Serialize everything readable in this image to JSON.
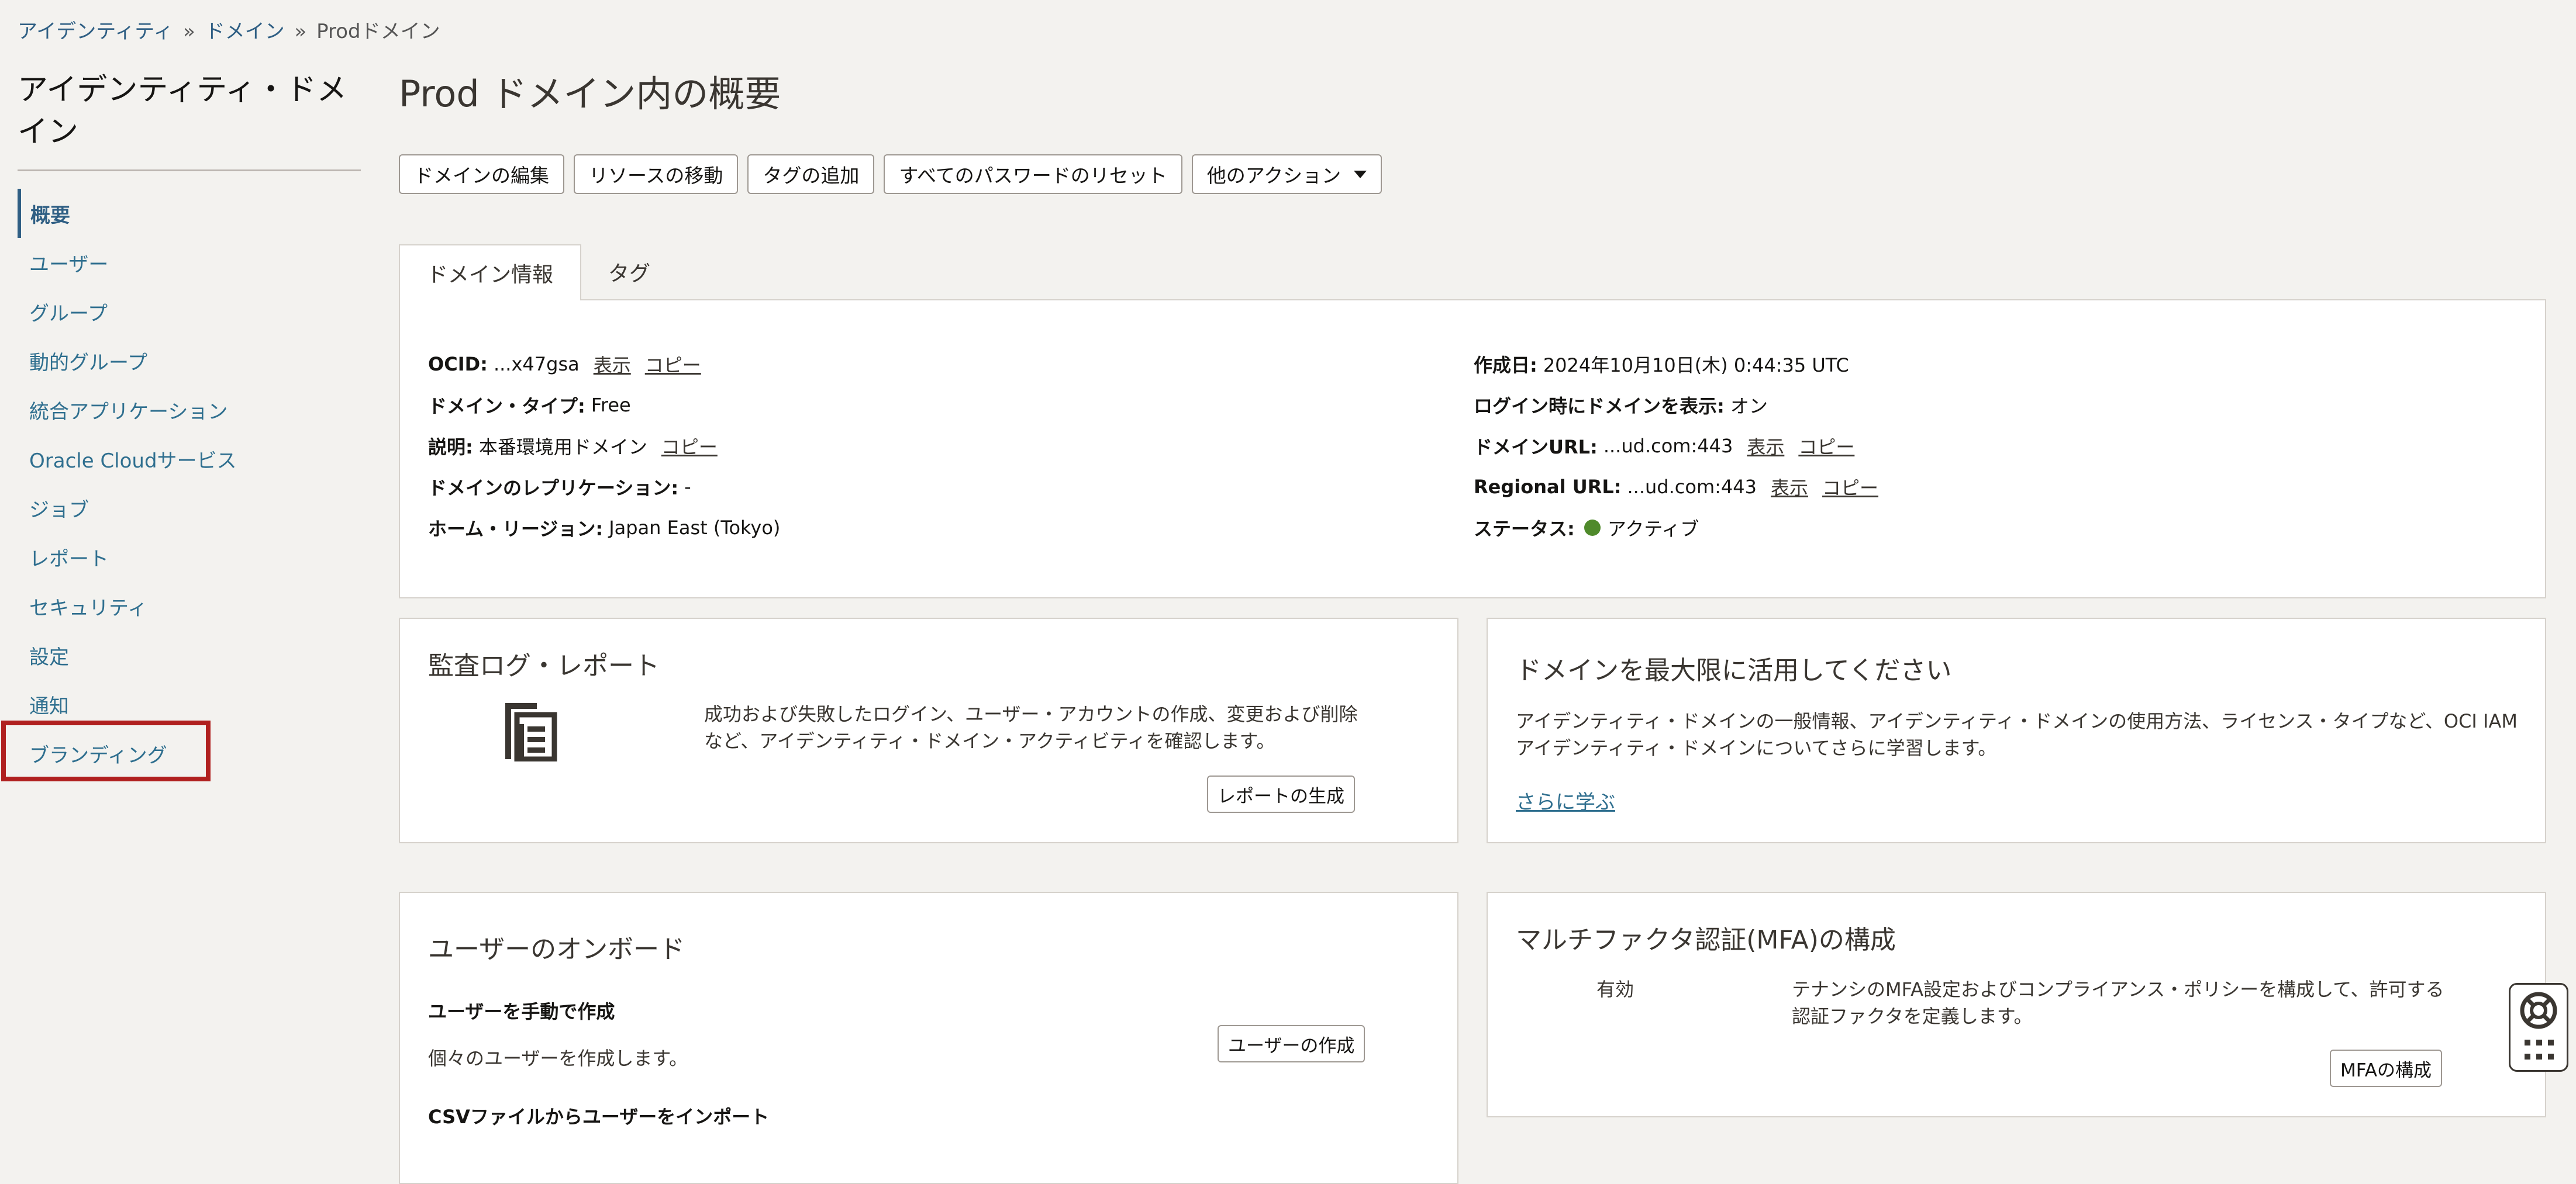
{
  "breadcrumb": {
    "items": [
      "アイデンティティ",
      "ドメイン",
      "Prodドメイン"
    ],
    "separator": "»"
  },
  "sidebar": {
    "title": "アイデンティティ・ドメイン",
    "items": [
      {
        "label": "概要",
        "active": true
      },
      {
        "label": "ユーザー"
      },
      {
        "label": "グループ"
      },
      {
        "label": "動的グループ"
      },
      {
        "label": "統合アプリケーション"
      },
      {
        "label": "Oracle Cloudサービス"
      },
      {
        "label": "ジョブ"
      },
      {
        "label": "レポート"
      },
      {
        "label": "セキュリティ"
      },
      {
        "label": "設定"
      },
      {
        "label": "通知"
      },
      {
        "label": "ブランディング",
        "highlighted": true
      }
    ]
  },
  "main": {
    "title": "Prod ドメイン内の概要",
    "actions": {
      "edit_domain": "ドメインの編集",
      "move_resource": "リソースの移動",
      "add_tags": "タグの追加",
      "reset_passwords": "すべてのパスワードのリセット",
      "more_actions": "他のアクション"
    },
    "tabs": [
      {
        "label": "ドメイン情報",
        "active": true
      },
      {
        "label": "タグ"
      }
    ],
    "info": {
      "ocid_key": "OCID:",
      "ocid_value": "...x47gsa",
      "show": "表示",
      "copy": "コピー",
      "domain_type_key": "ドメイン・タイプ:",
      "domain_type_value": "Free",
      "description_key": "説明:",
      "description_value": "本番環境用ドメイン",
      "replication_key": "ドメインのレプリケーション:",
      "replication_value": "-",
      "home_region_key": "ホーム・リージョン:",
      "home_region_value": "Japan East (Tokyo)",
      "created_key": "作成日:",
      "created_value": "2024年10月10日(木) 0:44:35 UTC",
      "show_on_login_key": "ログイン時にドメインを表示:",
      "show_on_login_value": "オン",
      "domain_url_key": "ドメインURL:",
      "domain_url_value": "...ud.com:443",
      "regional_url_key": "Regional URL:",
      "regional_url_value": "...ud.com:443",
      "status_key": "ステータス:",
      "status_value": "アクティブ",
      "status_color": "#4f8a2b"
    },
    "cards": {
      "audit": {
        "title": "監査ログ・レポート",
        "icon": "report-document-icon",
        "text": "成功および失敗したログイン、ユーザー・アカウントの作成、変更および削除など、アイデンティティ・ドメイン・アクティビティを確認します。",
        "button": "レポートの生成"
      },
      "maximize": {
        "title": "ドメインを最大限に活用してください",
        "text": "アイデンティティ・ドメインの一般情報、アイデンティティ・ドメインの使用方法、ライセンス・タイプなど、OCI IAMアイデンティティ・ドメインについてさらに学習します。",
        "link": "さらに学ぶ"
      },
      "onboard": {
        "title": "ユーザーのオンボード",
        "manual_title": "ユーザーを手動で作成",
        "manual_text": "個々のユーザーを作成します。",
        "button": "ユーザーの作成",
        "csv_title": "CSVファイルからユーザーをインポート"
      },
      "mfa": {
        "title": "マルチファクタ認証(MFA)の構成",
        "status": "有効",
        "text": "テナンシのMFA設定およびコンプライアンス・ポリシーを構成して、許可する認証ファクタを定義します。",
        "button": "MFAの構成"
      }
    }
  },
  "help_widget": {
    "icon": "lifebuoy-icon",
    "menu_icon": "grid-dots-icon"
  },
  "colors": {
    "accent": "#2f5f84",
    "link": "#2f6f8f",
    "highlight_border": "#b0201f",
    "background": "#f3f2ef"
  }
}
